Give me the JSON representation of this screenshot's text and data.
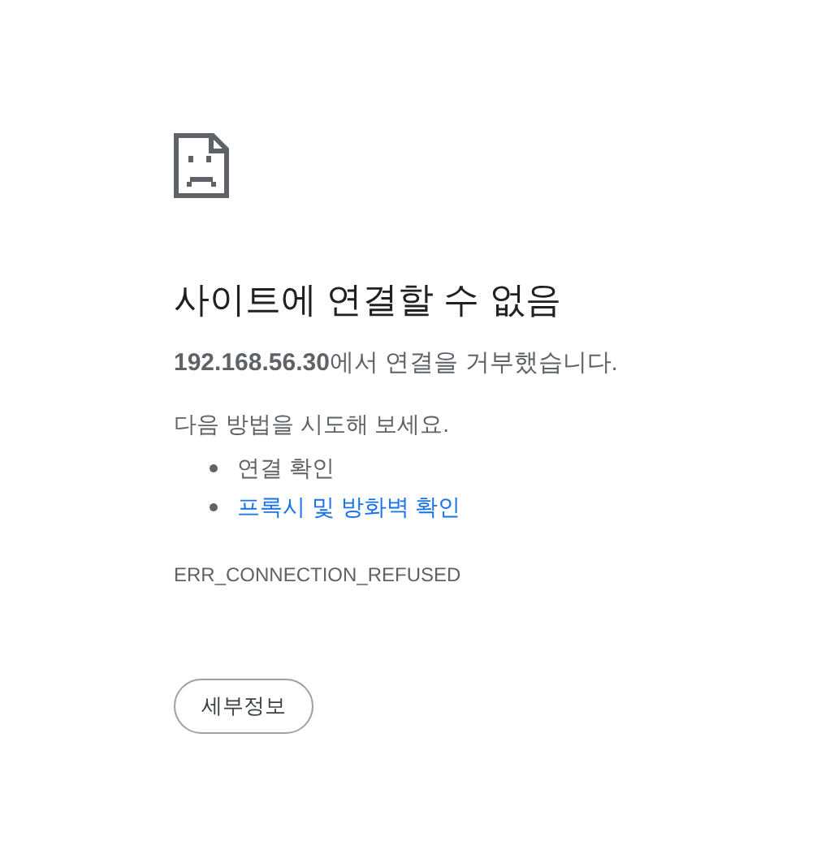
{
  "title": "사이트에 연결할 수 없음",
  "message": "**192.168.56.30**에서 연결을 거부했습니다.",
  "suggestions_heading": "다음 방법을 시도해 보세요.",
  "suggestions": [
    {
      "kind": "text",
      "label": "연결 확인"
    },
    {
      "kind": "link",
      "label": "프록시 및 방화벽 확인"
    }
  ],
  "error_code": "ERR_CONNECTION_REFUSED",
  "details_button": "세부정보"
}
